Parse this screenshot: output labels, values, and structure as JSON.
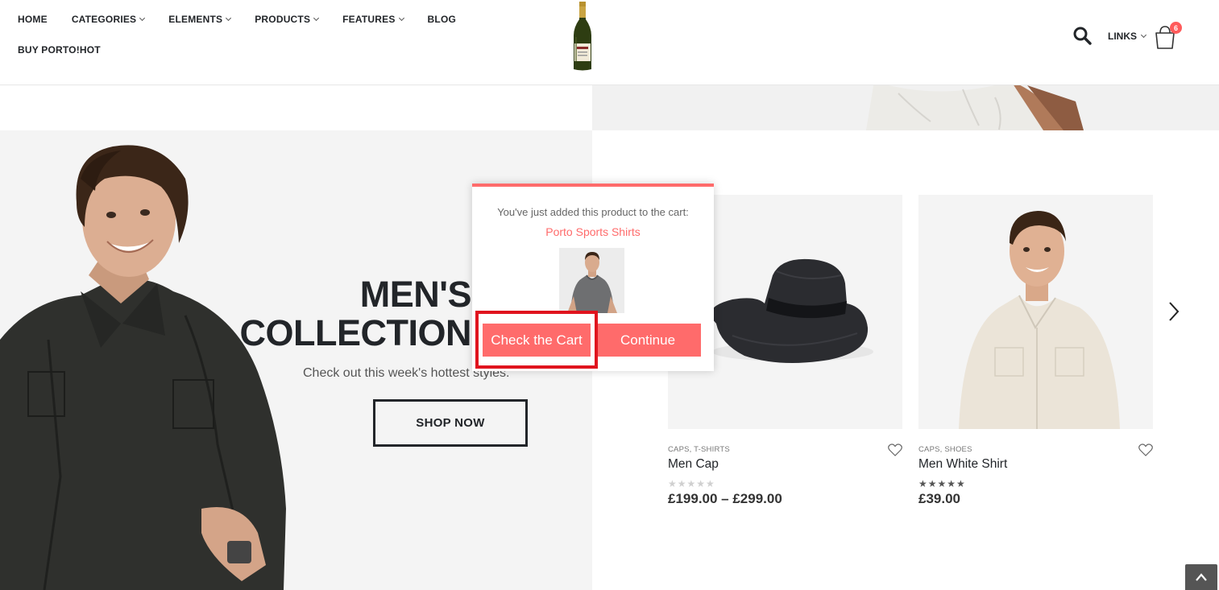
{
  "header": {
    "nav_row1": [
      {
        "label": "HOME",
        "dropdown": false
      },
      {
        "label": "CATEGORIES",
        "dropdown": true
      },
      {
        "label": "ELEMENTS",
        "dropdown": true
      },
      {
        "label": "PRODUCTS",
        "dropdown": true
      },
      {
        "label": "FEATURES",
        "dropdown": true
      },
      {
        "label": "BLOG",
        "dropdown": false
      }
    ],
    "nav_row2": [
      {
        "label": "BUY PORTO!HOT",
        "dropdown": false
      }
    ],
    "links_label": "LINKS",
    "cart_count": "6"
  },
  "hero": {
    "title_line1": "MEN'S",
    "title_line2": "COLLECTION",
    "subtitle": "Check out this week's hottest styles.",
    "button": "SHOP NOW"
  },
  "products": [
    {
      "categories": "CAPS, T-SHIRTS",
      "name": "Men Cap",
      "rating": 0,
      "price": "£199.00 – £299.00"
    },
    {
      "categories": "CAPS, SHOES",
      "name": "Men White Shirt",
      "rating": 5,
      "price": "£39.00"
    }
  ],
  "popup": {
    "message": "You've just added this product to the cart:",
    "product_name": "Porto Sports Shirts",
    "check_cart_label": "Check the Cart",
    "continue_label": "Continue"
  },
  "colors": {
    "accent": "#ff6b6b",
    "highlight": "#e0141e",
    "dark": "#222529",
    "badge": "#ff5b5b"
  },
  "icons": [
    "search-icon",
    "cart-icon",
    "heart-icon",
    "chevron-right-icon",
    "chevron-up-icon",
    "chevron-down-icon"
  ]
}
